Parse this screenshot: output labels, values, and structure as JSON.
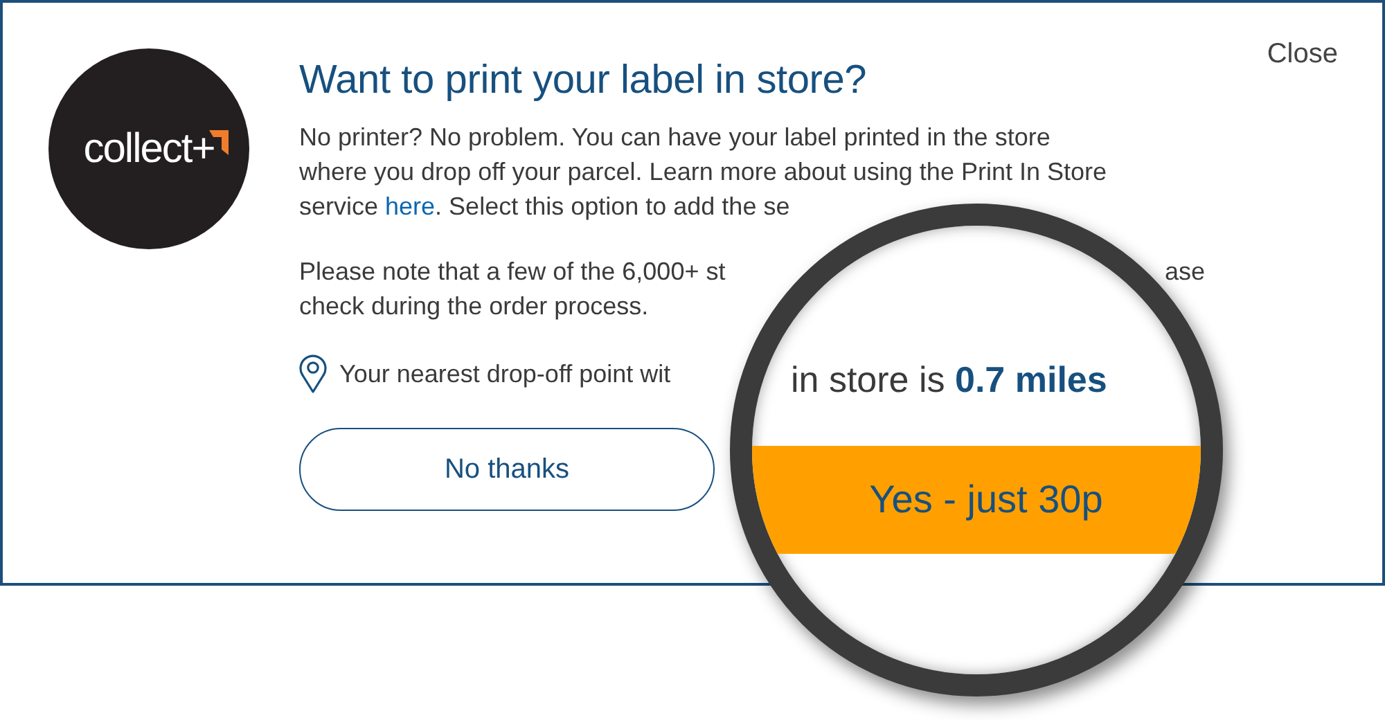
{
  "logo": {
    "text": "collect+"
  },
  "close": "Close",
  "title": "Want to print your label in store?",
  "intro": {
    "lines": [
      "No printer? No problem. You can have your label printed in the store",
      "where you drop off your parcel. Learn more about using the Print In Store"
    ],
    "last_before": "service ",
    "link": "here",
    "last_after": ". Select this option to add the se"
  },
  "note": {
    "lines": [
      "Please note that a few of the 6,000+ st",
      "check during the order process."
    ],
    "fragment": "ase"
  },
  "nearest": "Your nearest drop-off point wit",
  "no_thanks": "No thanks",
  "magnifier": {
    "text": "in store is **0.7 miles**",
    "button": "Yes - just 30p"
  }
}
